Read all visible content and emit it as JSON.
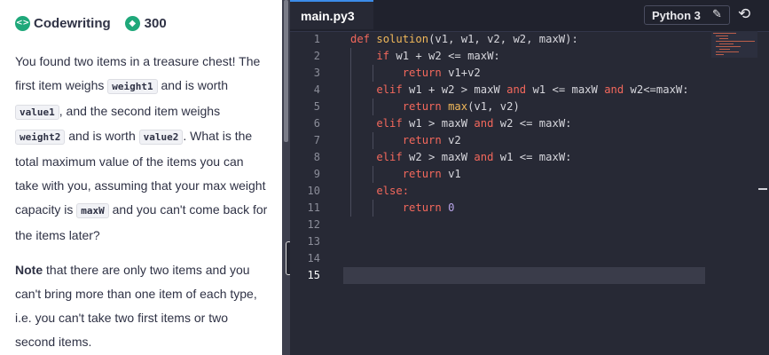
{
  "header": {
    "brand_label": "Codewriting",
    "brand_icon": "code-brackets-icon",
    "coin_icon": "coin-icon",
    "coins": "300"
  },
  "description": {
    "p1": [
      "You found two items in a treasure chest! The first item weighs ",
      "weight1",
      " and is worth ",
      "value1",
      ", and the second item weighs ",
      "weight2",
      " and is worth ",
      "value2",
      ". What is the total maximum value of the items you can take with you, assuming that your max weight capacity is ",
      "maxW",
      " and you can't come back for the items later?"
    ],
    "p2": [
      "Note",
      " that there are only two items and you can't bring more than one item of each type, i.e. you can't take two first items or two second items."
    ]
  },
  "editor": {
    "tab_label": "main.py3",
    "language": "Python 3",
    "edit_icon": "pencil-icon",
    "reset_icon": "reset-icon",
    "active_line": 15,
    "lines": [
      {
        "n": "1",
        "tokens": [
          [
            "def ",
            "kw"
          ],
          [
            "solution",
            "fn"
          ],
          [
            "(v1, w1, v2, w2, maxW):",
            "pl"
          ]
        ]
      },
      {
        "n": "2",
        "tokens": [
          [
            "    if ",
            "kw"
          ],
          [
            "w1 + w2 <= maxW:",
            "pl"
          ]
        ]
      },
      {
        "n": "3",
        "tokens": [
          [
            "        return ",
            "kw"
          ],
          [
            "v1+v2",
            "pl"
          ]
        ]
      },
      {
        "n": "4",
        "tokens": [
          [
            "    elif ",
            "kw"
          ],
          [
            "w1 + w2 > maxW ",
            "pl"
          ],
          [
            "and ",
            "kw"
          ],
          [
            "w1 <= maxW ",
            "pl"
          ],
          [
            "and ",
            "kw"
          ],
          [
            "w2<=maxW:",
            "pl"
          ]
        ]
      },
      {
        "n": "5",
        "tokens": [
          [
            "        return ",
            "kw"
          ],
          [
            "max",
            "fn"
          ],
          [
            "(v1, v2)",
            "pl"
          ]
        ]
      },
      {
        "n": "6",
        "tokens": [
          [
            "    elif ",
            "kw"
          ],
          [
            "w1 > maxW ",
            "pl"
          ],
          [
            "and ",
            "kw"
          ],
          [
            "w2 <= maxW:",
            "pl"
          ]
        ]
      },
      {
        "n": "7",
        "tokens": [
          [
            "        return ",
            "kw"
          ],
          [
            "v2",
            "pl"
          ]
        ]
      },
      {
        "n": "8",
        "tokens": [
          [
            "    elif ",
            "kw"
          ],
          [
            "w2 > maxW ",
            "pl"
          ],
          [
            "and ",
            "kw"
          ],
          [
            "w1 <= maxW:",
            "pl"
          ]
        ]
      },
      {
        "n": "9",
        "tokens": [
          [
            "        return ",
            "kw"
          ],
          [
            "v1",
            "pl"
          ]
        ]
      },
      {
        "n": "10",
        "tokens": [
          [
            "    else:",
            "kw"
          ]
        ]
      },
      {
        "n": "11",
        "tokens": [
          [
            "        return ",
            "kw"
          ],
          [
            "0",
            "nm"
          ]
        ]
      },
      {
        "n": "12",
        "tokens": []
      },
      {
        "n": "13",
        "tokens": []
      },
      {
        "n": "14",
        "tokens": []
      },
      {
        "n": "15",
        "tokens": []
      }
    ]
  }
}
